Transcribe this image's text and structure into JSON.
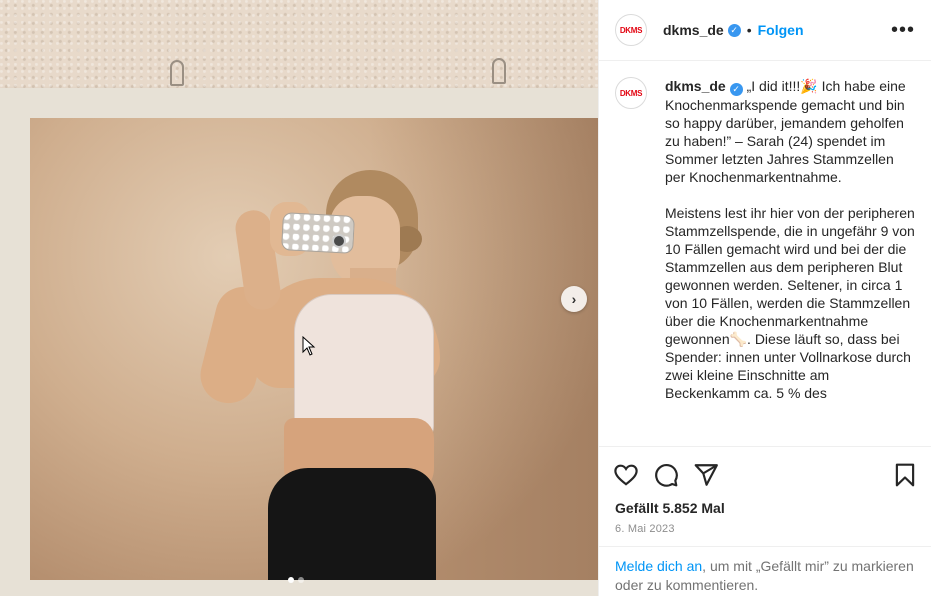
{
  "post": {
    "username": "dkms_de",
    "avatar_text": "DKMS",
    "separator": "•",
    "follow_label": "Folgen",
    "more_label": "•••",
    "caption_paragraph_1": "„I did it!!!🎉 Ich habe eine Knochenmarkspende gemacht und bin so happy darüber, jemandem geholfen zu haben!” – Sarah (24) spendet im Sommer letzten Jahres Stammzellen per Knochenmarkentnahme.",
    "caption_paragraph_2": "Meistens lest ihr hier von der peripheren Stammzellspende, die in ungefähr 9 von 10 Fällen gemacht wird und bei der die Stammzellen aus dem peripheren Blut gewonnen werden. Seltener, in circa 1 von 10 Fällen, werden die Stammzellen über die Knochenmarkentnahme gewonnen🦴. Diese läuft so, dass bei Spender: innen unter Vollnarkose durch zwei kleine Einschnitte am Beckenkamm ca. 5 % des",
    "likes": "Gefällt 5.852 Mal",
    "date": "6. Mai 2023",
    "login_link": "Melde dich an",
    "login_rest": ", um mit „Gefällt mir” zu markieren oder zu kommentieren."
  },
  "carousel": {
    "next_label": "›",
    "slides": 2,
    "active_slide": 1
  },
  "icons": [
    "heart-icon",
    "comment-icon",
    "share-icon",
    "bookmark-icon",
    "verified-badge-icon",
    "chevron-right-icon"
  ],
  "colors": {
    "brand_red": "#e30613",
    "link_blue": "#0095f6",
    "verified_blue": "#3897f0",
    "muted": "#8e8e8e"
  }
}
